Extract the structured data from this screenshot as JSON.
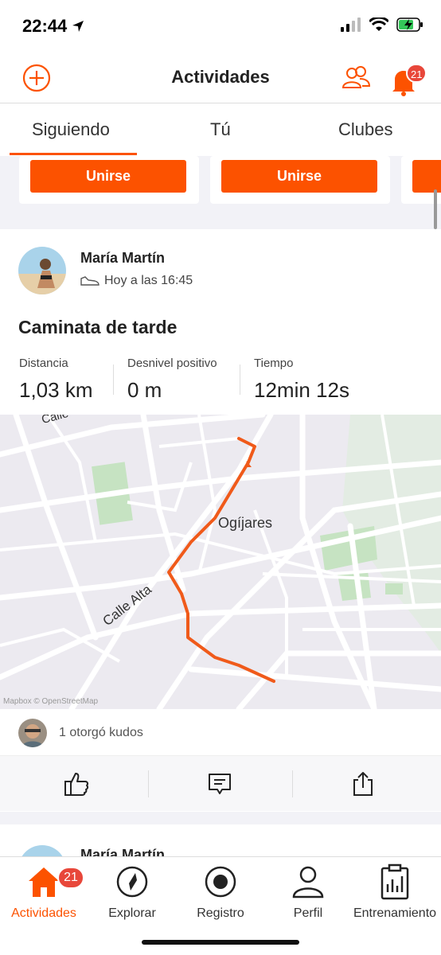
{
  "status_bar": {
    "time": "22:44"
  },
  "header": {
    "title": "Actividades",
    "notification_count": "21"
  },
  "tabs": [
    {
      "label": "Siguiendo",
      "active": true
    },
    {
      "label": "Tú",
      "active": false
    },
    {
      "label": "Clubes",
      "active": false
    }
  ],
  "clubs": {
    "join_label": "Unirse"
  },
  "activity": {
    "athlete": "María Martín",
    "time": "Hoy a las 16:45",
    "title": "Caminata de tarde",
    "stats": [
      {
        "label": "Distancia",
        "value": "1,03 km"
      },
      {
        "label": "Desnivel positivo",
        "value": "0 m"
      },
      {
        "label": "Tiempo",
        "value": "12min 12s"
      }
    ],
    "map": {
      "place_label": "Ogíjares",
      "street_label": "Calle Alta",
      "street_label_2": "Calle",
      "attribution": "Mapbox © OpenStreetMap"
    },
    "kudos": "1 otorgó kudos"
  },
  "next_activity": {
    "athlete": "María Martín"
  },
  "bottom_nav": [
    {
      "label": "Actividades",
      "badge": "21",
      "active": true
    },
    {
      "label": "Explorar"
    },
    {
      "label": "Registro"
    },
    {
      "label": "Perfil"
    },
    {
      "label": "Entrenamiento"
    }
  ],
  "colors": {
    "accent": "#fc5200",
    "badge": "#e8473a",
    "route": "#f05a1a"
  }
}
